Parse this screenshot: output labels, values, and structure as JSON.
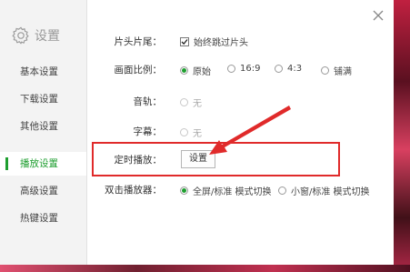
{
  "sidebar": {
    "title": "设置",
    "items": [
      {
        "label": "基本设置"
      },
      {
        "label": "下载设置"
      },
      {
        "label": "其他设置"
      },
      {
        "label": "播放设置"
      },
      {
        "label": "高级设置"
      },
      {
        "label": "热键设置"
      }
    ],
    "active_index": 3
  },
  "settings": {
    "skip_intro": {
      "label": "片头片尾：",
      "option": "始终跳过片头",
      "checked": true
    },
    "aspect": {
      "label": "画面比例：",
      "options": [
        "原始",
        "16:9",
        "4:3",
        "铺满"
      ],
      "selected": "原始"
    },
    "audio": {
      "label": "音轨：",
      "option": "无"
    },
    "subtitle": {
      "label": "字幕：",
      "option": "无"
    },
    "timer": {
      "label": "定时播放：",
      "button": "设置"
    },
    "double_click": {
      "label": "双击播放器：",
      "options": [
        "全屏/标准 模式切换",
        "小窗/标准 模式切换"
      ],
      "selected": "全屏/标准 模式切换"
    }
  },
  "colors": {
    "accent": "#1e9e2f",
    "highlight": "#e02a2a"
  }
}
